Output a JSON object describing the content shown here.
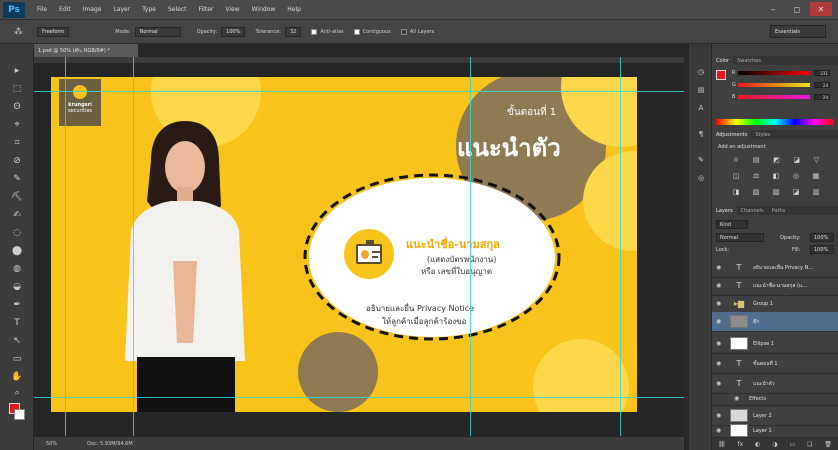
{
  "app": {
    "logo": "Ps",
    "menu": [
      "File",
      "Edit",
      "Image",
      "Layer",
      "Type",
      "Select",
      "Filter",
      "View",
      "Window",
      "Help"
    ],
    "window_controls": [
      "–",
      "◻",
      "✕"
    ]
  },
  "options_bar": {
    "tool_preset": "Freeform",
    "mode_label": "Mode:",
    "mode_value": "Normal",
    "opacity_label": "Opacity:",
    "opacity_value": "100%",
    "tolerance_label": "Tolerance:",
    "tolerance_value": "32",
    "antialias_label": "Anti-alias",
    "contiguous_label": "Contiguous",
    "all_layers_label": "All Layers",
    "workspace": "Essentials"
  },
  "document": {
    "tab_title": "1.psd @ 50% (ตุ๊ก, RGB/8#) *",
    "zoom_status": "50%",
    "doc_status": "Doc: 5.93M/94.6M"
  },
  "canvas": {
    "logo_name": "krungsri",
    "logo_sub": "securities",
    "step_label": "ขั้นตอนที่ 1",
    "heading": "แนะนำตัว",
    "intro_title": "แนะนำชื่อ-นามสกุล",
    "intro_line1": "(แสดงบัตรพนักงาน)",
    "intro_line2": "หรือ เลขที่ใบอนุญาต",
    "privacy_line1": "อธิบายและยื่น Privacy Notice",
    "privacy_line2": "ให้ลูกค้าเมื่อลูกค้าร้องขอ",
    "colors": {
      "background": "#f8c31a",
      "brown": "#8f7a52",
      "white": "#ffffff",
      "accent": "#f0a800"
    }
  },
  "panels": {
    "color_tabs": [
      "Color",
      "Swatches"
    ],
    "color_values": {
      "r": "231",
      "g": "24",
      "b": "24"
    },
    "adjust_tabs": [
      "Adjustments",
      "Styles"
    ],
    "adjust_title": "Add an adjustment",
    "adjust_icons_row1": [
      "☼",
      "▤",
      "◩",
      "◪",
      "▽"
    ],
    "adjust_icons_row2": [
      "◫",
      "⚖",
      "◧",
      "◎",
      "▦"
    ],
    "adjust_icons_row3": [
      "◨",
      "▨",
      "▧",
      "◪",
      "▥"
    ],
    "layers_tabs": [
      "Layers",
      "Channels",
      "Paths"
    ],
    "kind_label": "Kind",
    "blend_mode": "Normal",
    "opacity_label": "Opacity:",
    "opacity_value": "100%",
    "lock_label": "Lock:",
    "fill_label": "Fill:",
    "fill_value": "100%",
    "layers": [
      {
        "name": "อธิบายและยื่น Privacy N...",
        "type": "text"
      },
      {
        "name": "แนะนำชื่อ-นามสกุล (แ...",
        "type": "text"
      },
      {
        "name": "Group 1",
        "type": "folder"
      },
      {
        "name": "ตุ๊ก",
        "type": "image"
      },
      {
        "name": "Ellipse 1",
        "type": "shape"
      },
      {
        "name": "ขั้นตอนที่ 1",
        "type": "text"
      },
      {
        "name": "แนะนำตัว",
        "type": "text"
      },
      {
        "name": "Effects",
        "type": "effect"
      },
      {
        "name": "Layer 2",
        "type": "image"
      },
      {
        "name": "Layer 1",
        "type": "image"
      }
    ],
    "footer_icons": [
      "⛓",
      "fx",
      "◐",
      "◑",
      "▭",
      "❏",
      "🗑"
    ]
  },
  "tools": [
    "▸",
    "⬚",
    "ʘ",
    "⌖",
    "⌗",
    "⊘",
    "✎",
    "⛏",
    "✍",
    "◌",
    "⬤",
    "◍",
    "◒",
    "✒",
    "T",
    "↖",
    "▭",
    "✋",
    "⌕"
  ]
}
